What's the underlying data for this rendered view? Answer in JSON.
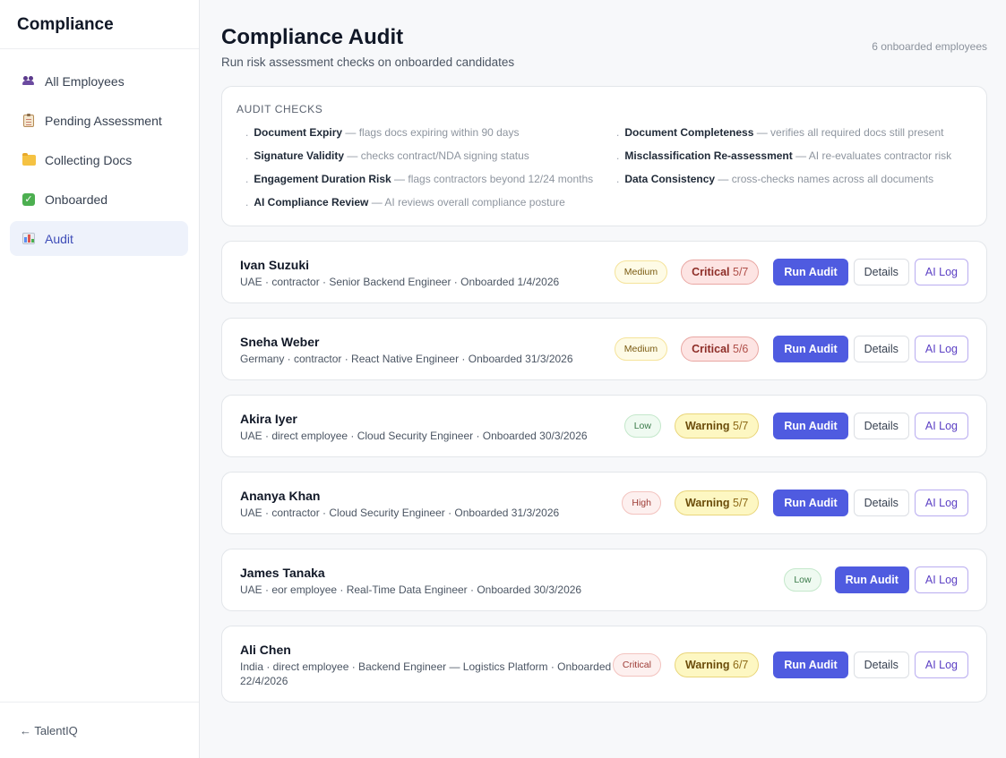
{
  "sidebar": {
    "brand": "Compliance",
    "items": [
      {
        "label": "All Employees",
        "icon": "people-icon"
      },
      {
        "label": "Pending Assessment",
        "icon": "clipboard-icon"
      },
      {
        "label": "Collecting Docs",
        "icon": "folder-icon"
      },
      {
        "label": "Onboarded",
        "icon": "check-icon"
      },
      {
        "label": "Audit",
        "icon": "bar-chart-icon",
        "active": true
      }
    ],
    "footer_link": "← TalentIQ"
  },
  "header": {
    "title": "Compliance Audit",
    "subtitle": "Run risk assessment checks on onboarded candidates",
    "count": "6 onboarded employees"
  },
  "checks": {
    "heading": "AUDIT CHECKS",
    "items": [
      {
        "name": "Document Expiry",
        "desc": " — flags docs expiring within 90 days"
      },
      {
        "name": "Document Completeness",
        "desc": " — verifies all required docs still present"
      },
      {
        "name": "Signature Validity",
        "desc": " — checks contract/NDA signing status"
      },
      {
        "name": "Misclassification Re-assessment",
        "desc": " — AI re-evaluates contractor risk"
      },
      {
        "name": "Engagement Duration Risk",
        "desc": " — flags contractors beyond 12/24 months"
      },
      {
        "name": "Data Consistency",
        "desc": " — cross-checks names across all documents"
      },
      {
        "name": "AI Compliance Review",
        "desc": " — AI reviews overall compliance posture"
      }
    ]
  },
  "buttons": {
    "run_audit": "Run Audit",
    "details": "Details",
    "ai_log": "AI Log"
  },
  "employees": [
    {
      "name": "Ivan Suzuki",
      "meta": "UAE · contractor · Senior Backend Engineer · Onboarded 1/4/2026",
      "risk": "Medium",
      "status": "Critical",
      "score": "5/7"
    },
    {
      "name": "Sneha Weber",
      "meta": "Germany · contractor · React Native Engineer · Onboarded 31/3/2026",
      "risk": "Medium",
      "status": "Critical",
      "score": "5/6"
    },
    {
      "name": "Akira Iyer",
      "meta": "UAE · direct employee · Cloud Security Engineer · Onboarded 30/3/2026",
      "risk": "Low",
      "status": "Warning",
      "score": "5/7"
    },
    {
      "name": "Ananya Khan",
      "meta": "UAE · contractor · Cloud Security Engineer · Onboarded 31/3/2026",
      "risk": "High",
      "status": "Warning",
      "score": "5/7"
    },
    {
      "name": "James Tanaka",
      "meta": "UAE · eor employee · Real-Time Data Engineer · Onboarded 30/3/2026",
      "risk": "Low"
    },
    {
      "name": "Ali Chen",
      "meta": "India · direct employee · Backend Engineer — Logistics Platform · Onboarded 22/4/2026",
      "risk": "Critical",
      "status": "Warning",
      "score": "6/7"
    }
  ],
  "colors": {
    "accent": "#4f5be0",
    "active_nav_bg": "#eef2fb",
    "critical": "#e9a7a3",
    "warning": "#e9d57a"
  }
}
